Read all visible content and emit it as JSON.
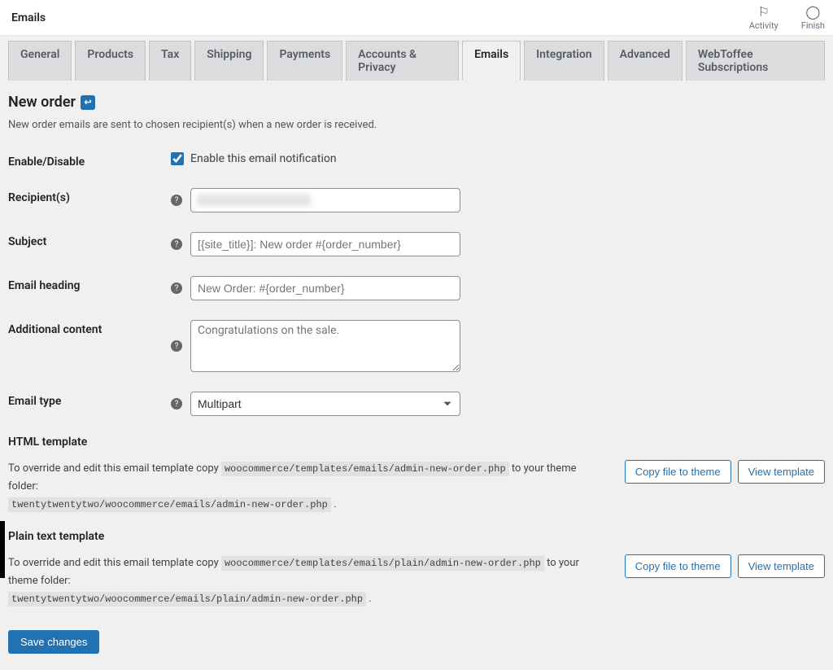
{
  "topbar": {
    "title": "Emails",
    "activity_label": "Activity",
    "finish_label": "Finish"
  },
  "tabs": [
    "General",
    "Products",
    "Tax",
    "Shipping",
    "Payments",
    "Accounts & Privacy",
    "Emails",
    "Integration",
    "Advanced",
    "WebToffee Subscriptions"
  ],
  "active_tab": "Emails",
  "page": {
    "title": "New order",
    "description": "New order emails are sent to chosen recipient(s) when a new order is received."
  },
  "form": {
    "enable_label": "Enable/Disable",
    "enable_checkbox_label": "Enable this email notification",
    "enable_checked": true,
    "recipients_label": "Recipient(s)",
    "recipients_value": "",
    "subject_label": "Subject",
    "subject_placeholder": "[{site_title}]: New order #{order_number}",
    "heading_label": "Email heading",
    "heading_placeholder": "New Order: #{order_number}",
    "additional_label": "Additional content",
    "additional_placeholder": "Congratulations on the sale.",
    "emailtype_label": "Email type",
    "emailtype_value": "Multipart"
  },
  "templates": {
    "html": {
      "title": "HTML template",
      "desc_prefix": "To override and edit this email template copy ",
      "path1": "woocommerce/templates/emails/admin-new-order.php",
      "desc_mid": " to your theme folder: ",
      "path2": "twentytwentytwo/woocommerce/emails/admin-new-order.php",
      "copy_btn": "Copy file to theme",
      "view_btn": "View template"
    },
    "plain": {
      "title": "Plain text template",
      "desc_prefix": "To override and edit this email template copy ",
      "path1": "woocommerce/templates/emails/plain/admin-new-order.php",
      "desc_mid": " to your theme folder: ",
      "path2": "twentytwentytwo/woocommerce/emails/plain/admin-new-order.php",
      "copy_btn": "Copy file to theme",
      "view_btn": "View template"
    }
  },
  "save_button": "Save changes"
}
